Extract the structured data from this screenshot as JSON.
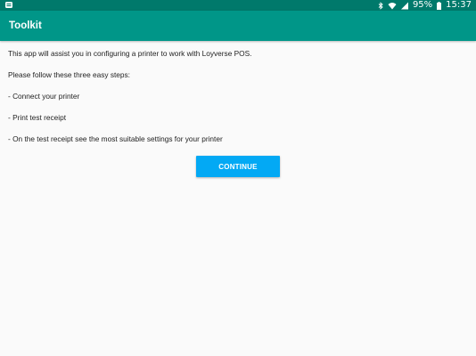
{
  "status_bar": {
    "left_icon": "app-notification-icon",
    "icons": [
      "bluetooth-icon",
      "wifi-icon",
      "signal-icon"
    ],
    "battery": "95%",
    "time": "15:37",
    "color": "#00796b"
  },
  "app_bar": {
    "title": "Toolkit",
    "color": "#009688"
  },
  "content": {
    "intro": "This app will assist you in configuring a printer to work with Loyverse POS.",
    "follow": "Please follow these three easy steps:",
    "steps": [
      "- Connect your printer",
      "- Print test receipt",
      "- On the test receipt see the most suitable settings for your printer"
    ]
  },
  "continue_button": {
    "label": "CONTINUE",
    "color": "#03a9f4"
  }
}
